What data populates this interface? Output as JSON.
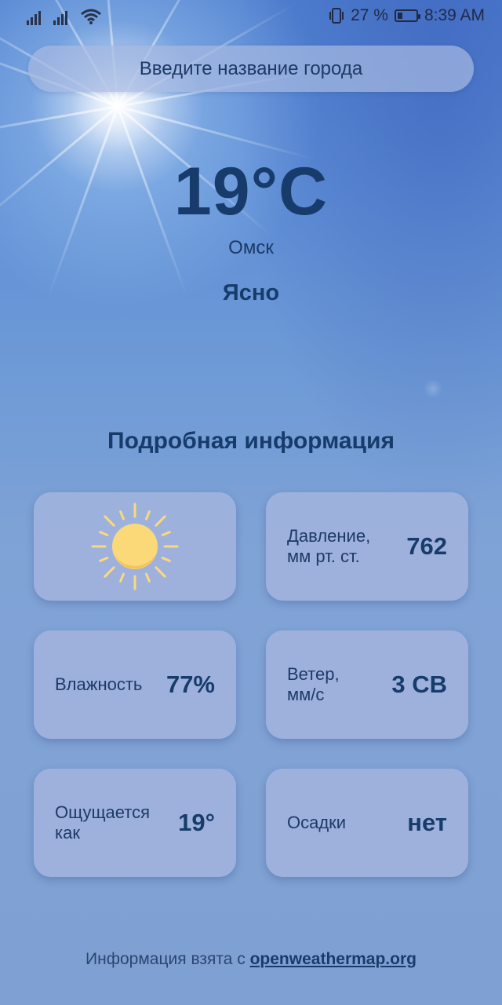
{
  "status_bar": {
    "battery_percent": "27 %",
    "battery_level": 0.27,
    "time": "8:39 AM",
    "icons": [
      "signal-icon",
      "signal-icon",
      "wifi-icon",
      "vibrate-icon",
      "battery-icon"
    ]
  },
  "search": {
    "placeholder": "Введите название города"
  },
  "weather": {
    "temperature": "19°C",
    "city": "Омск",
    "condition": "Ясно",
    "icon": "sun-icon"
  },
  "details": {
    "title": "Подробная информация",
    "pressure": {
      "label_line1": "Давление,",
      "label_line2": "мм рт. ст.",
      "value": "762"
    },
    "humidity": {
      "label": "Влажность",
      "value": "77%"
    },
    "wind": {
      "label_line1": "Ветер,",
      "label_line2": "мм/с",
      "value": "3 СВ"
    },
    "feels_like": {
      "label_line1": "Ощущается",
      "label_line2": "как",
      "value": "19°"
    },
    "precipitation": {
      "label": "Осадки",
      "value": "нет"
    }
  },
  "footer": {
    "text": "Информация взята с ",
    "link": "openweathermap.org"
  },
  "colors": {
    "text_primary": "#173c6b",
    "sun_fill": "#fcd978",
    "sun_rays": "#fcd978"
  }
}
